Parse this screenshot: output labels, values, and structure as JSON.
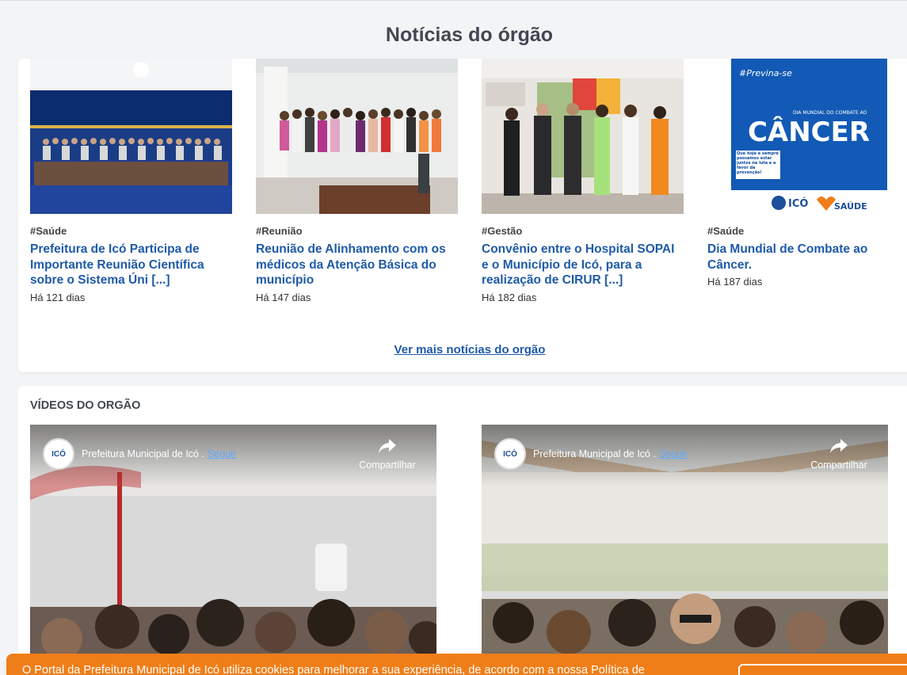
{
  "news": {
    "title": "Notícias do órgão",
    "items": [
      {
        "tag": "#Saúde",
        "headline": "Prefeitura de Icó Participa de Importante Reunião Científica sobre o Sistema Úni [...]",
        "age": "Há 121 dias"
      },
      {
        "tag": "#Reunião",
        "headline": "Reunião de Alinhamento com os médicos da Atenção Básica do município",
        "age": "Há 147 dias"
      },
      {
        "tag": "#Gestão",
        "headline": "Convênio entre o Hospital SOPAI e o Município de Icó, para a realização de CIRUR [...]",
        "age": "Há 182 dias"
      },
      {
        "tag": "#Saúde",
        "headline": "Dia Mundial de Combate ao Câncer.",
        "age": "Há 187 dias"
      }
    ],
    "poster": {
      "hashtag": "#Previna-se",
      "subtitle": "DIA MUNDIAL DO COMBATE AO",
      "headline": "CÂNCER",
      "message": "Que hoje e sempre possamos estar juntos na luta e a favor da prevenção!",
      "logo1": "ICÓ",
      "logo2": "SAÚDE"
    },
    "more_label": "Ver mais notícias do orgão"
  },
  "videos": {
    "heading": "VÍDEOS DO ORGÃO",
    "channel": "Prefeitura Municipal de Icó .",
    "follow": "Seguir",
    "share": "Compartilhar",
    "logo_text": "ICÓ"
  },
  "cookie": {
    "text": "O Portal da Prefeitura Municipal de Icó utiliza cookies para melhorar a sua experiência, de acordo com a nossa Política de"
  }
}
